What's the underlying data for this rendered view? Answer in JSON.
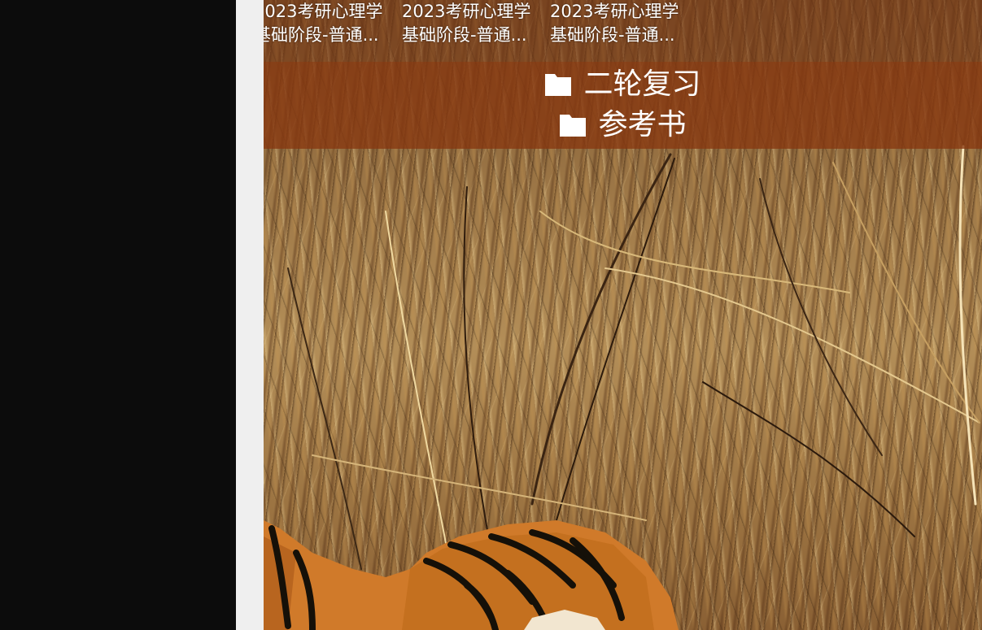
{
  "shared_items": [
    {
      "line1": "2023考研心理学",
      "line2": "基础阶段-普通..."
    },
    {
      "line1": "2023考研心理学",
      "line2": "基础阶段-普通..."
    },
    {
      "line1": "2023考研心理学",
      "line2": "基础阶段-普通..."
    }
  ],
  "folders": [
    {
      "label": "二轮复习",
      "icon": "folder-icon"
    },
    {
      "label": "参考书",
      "icon": "folder-icon"
    }
  ],
  "colors": {
    "left_panel": "#0c0c0c",
    "gutter": "#efefef",
    "folder_band": "#87370f",
    "text": "#ffffff"
  }
}
